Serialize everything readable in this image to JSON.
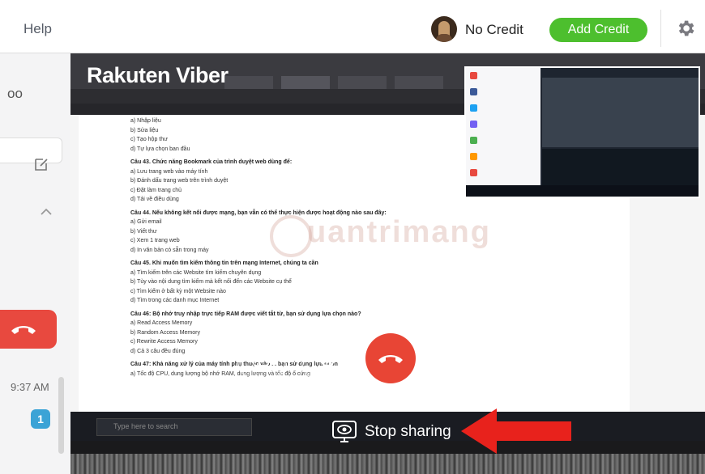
{
  "topbar": {
    "help_label": "Help",
    "credit_label": "No Credit",
    "add_credit_label": "Add Credit",
    "accent_color": "#4dbf2e"
  },
  "sidebar": {
    "partial_name": "oo",
    "call_time": "9:37 AM",
    "unread_count": "1"
  },
  "share": {
    "logo": "Rakuten Viber",
    "watermark": "uantrimang",
    "stop_label": "Stop sharing",
    "taskbar_search_placeholder": "Type here to search"
  },
  "shared_page": {
    "lines": [
      {
        "text": "a) Nhập liệu",
        "bold": false
      },
      {
        "text": "b) Sửa liệu",
        "bold": false
      },
      {
        "text": "c) Tạo hộp thư",
        "bold": false
      },
      {
        "text": "d) Tự lựa chọn ban đầu",
        "bold": false
      },
      {
        "text": "Câu 43. Chức năng Bookmark của trình duyệt web dùng để:",
        "bold": true
      },
      {
        "text": "a) Lưu trang web vào máy tính",
        "bold": false
      },
      {
        "text": "b) Đánh dấu trang web trên trình duyệt",
        "bold": false
      },
      {
        "text": "c) Đặt làm trang chủ",
        "bold": false
      },
      {
        "text": "d) Tải về điều dùng",
        "bold": false
      },
      {
        "text": "Câu 44. Nếu không kết nối được mạng, bạn vẫn có thể thực hiện được hoạt động nào sau đây:",
        "bold": true
      },
      {
        "text": "a) Gửi email",
        "bold": false
      },
      {
        "text": "b) Viết thư",
        "bold": false
      },
      {
        "text": "c) Xem 1 trang web",
        "bold": false
      },
      {
        "text": "d) In văn bản có sẵn trong máy",
        "bold": false
      },
      {
        "text": "Câu 45. Khi muốn tìm kiếm thông tin trên mạng Internet, chúng ta cần",
        "bold": true
      },
      {
        "text": "a) Tìm kiếm trên các Website tìm kiếm chuyên dụng",
        "bold": false
      },
      {
        "text": "b) Tùy vào nội dung tìm kiếm mà kết nối đến các Website cụ thể",
        "bold": false
      },
      {
        "text": "c) Tìm kiếm ở bất kỳ một Website nào",
        "bold": false
      },
      {
        "text": "d) Tìm trong các danh mục Internet",
        "bold": false
      },
      {
        "text": "Câu 46: Bộ nhớ truy nhập trực tiếp RAM được viết tắt từ, bạn sử dụng lựa chọn nào?",
        "bold": true
      },
      {
        "text": "a) Read Access Memory",
        "bold": false
      },
      {
        "text": "b) Random Access Memory",
        "bold": false
      },
      {
        "text": "c) Rewrite Access Memory",
        "bold": false
      },
      {
        "text": "d) Cả 3 câu đều đúng",
        "bold": false
      },
      {
        "text": "Câu 47: Khả năng xử lý của máy tính phụ thuộc vào ... bạn sử dụng lựa chọn",
        "bold": true
      },
      {
        "text": "a) Tốc độ CPU, dung lượng bộ nhớ RAM, dung lượng và tốc độ ổ cứng",
        "bold": false
      }
    ]
  },
  "controls": {
    "hangup_color": "#e84535"
  }
}
